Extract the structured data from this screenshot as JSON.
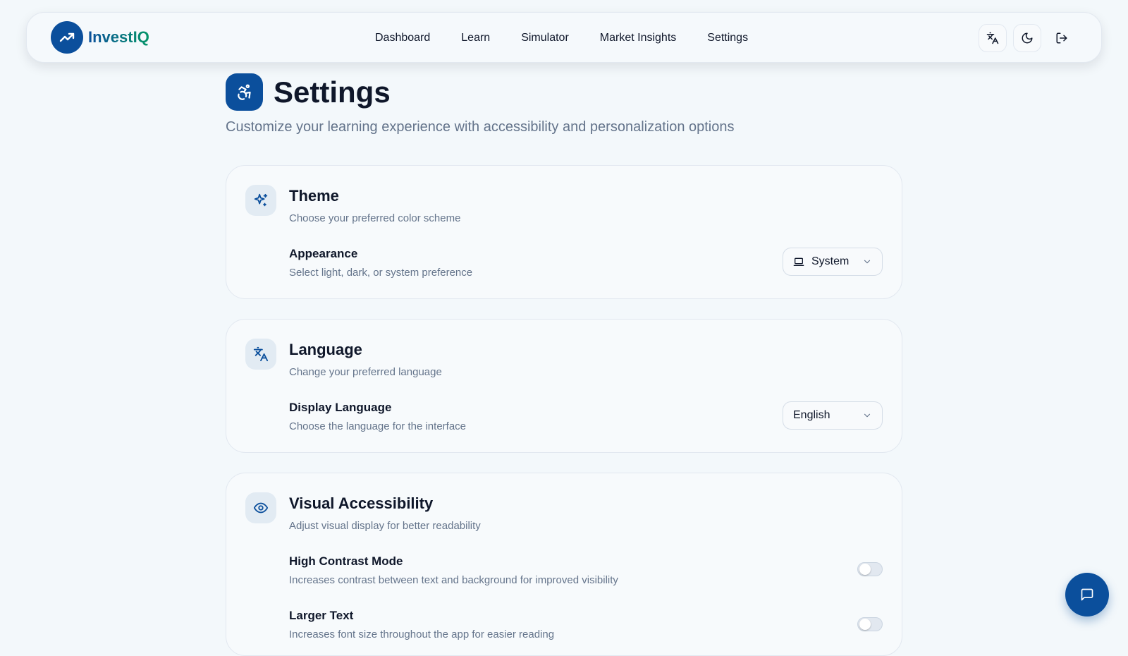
{
  "brand": {
    "name": "InvestIQ",
    "logo_icon": "trending-up-icon"
  },
  "nav": {
    "links": [
      "Dashboard",
      "Learn",
      "Simulator",
      "Market Insights",
      "Settings"
    ],
    "actions": [
      "translate-icon",
      "moon-icon",
      "logout-icon"
    ]
  },
  "page": {
    "icon": "accessibility-icon",
    "title": "Settings",
    "subtitle": "Customize your learning experience with accessibility and personalization options"
  },
  "theme": {
    "icon": "sparkles-icon",
    "title": "Theme",
    "description": "Choose your preferred color scheme",
    "appearance": {
      "label": "Appearance",
      "description": "Select light, dark, or system preference",
      "value": "System",
      "value_icon": "laptop-icon"
    }
  },
  "language": {
    "icon": "translate-icon",
    "title": "Language",
    "description": "Change your preferred language",
    "display": {
      "label": "Display Language",
      "description": "Choose the language for the interface",
      "value": "English"
    }
  },
  "visual": {
    "icon": "eye-icon",
    "title": "Visual Accessibility",
    "description": "Adjust visual display for better readability",
    "high_contrast": {
      "label": "High Contrast Mode",
      "description": "Increases contrast between text and background for improved visibility",
      "enabled": false
    },
    "larger_text": {
      "label": "Larger Text",
      "description": "Increases font size throughout the app for easier reading",
      "enabled": false
    }
  },
  "chat": {
    "icon": "chat-icon"
  },
  "colors": {
    "primary": "#0b4f9c",
    "accent": "#059669",
    "background": "#f3f8fb"
  }
}
